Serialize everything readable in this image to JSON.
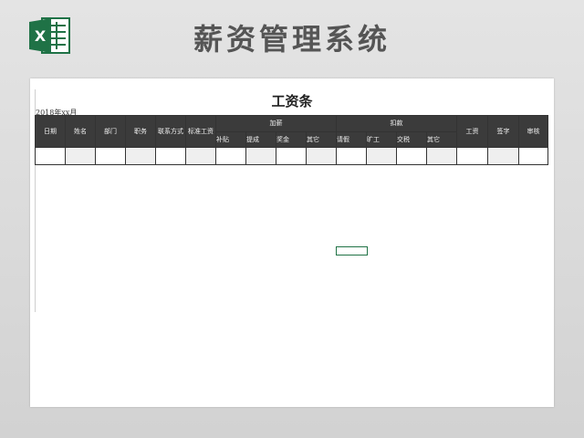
{
  "header": {
    "title": "薪资管理系统",
    "logo_icon": "excel-icon",
    "accent_color": "#1f7246"
  },
  "sheet": {
    "title": "工资条",
    "date_label": "2018年xx月",
    "header_bg_color": "#3b3b3b",
    "columns": {
      "date": "日期",
      "name": "姓名",
      "department": "部门",
      "position": "职务",
      "contact": "联系方式",
      "base_salary": "标准工资",
      "add_group": "加薪",
      "add_items": [
        "补贴",
        "提成",
        "奖金",
        "其它"
      ],
      "deduct_group": "扣款",
      "deduct_items": [
        "请假",
        "旷工",
        "交税",
        "其它"
      ],
      "salary": "工资",
      "signature": "签字",
      "review": "审核"
    }
  }
}
